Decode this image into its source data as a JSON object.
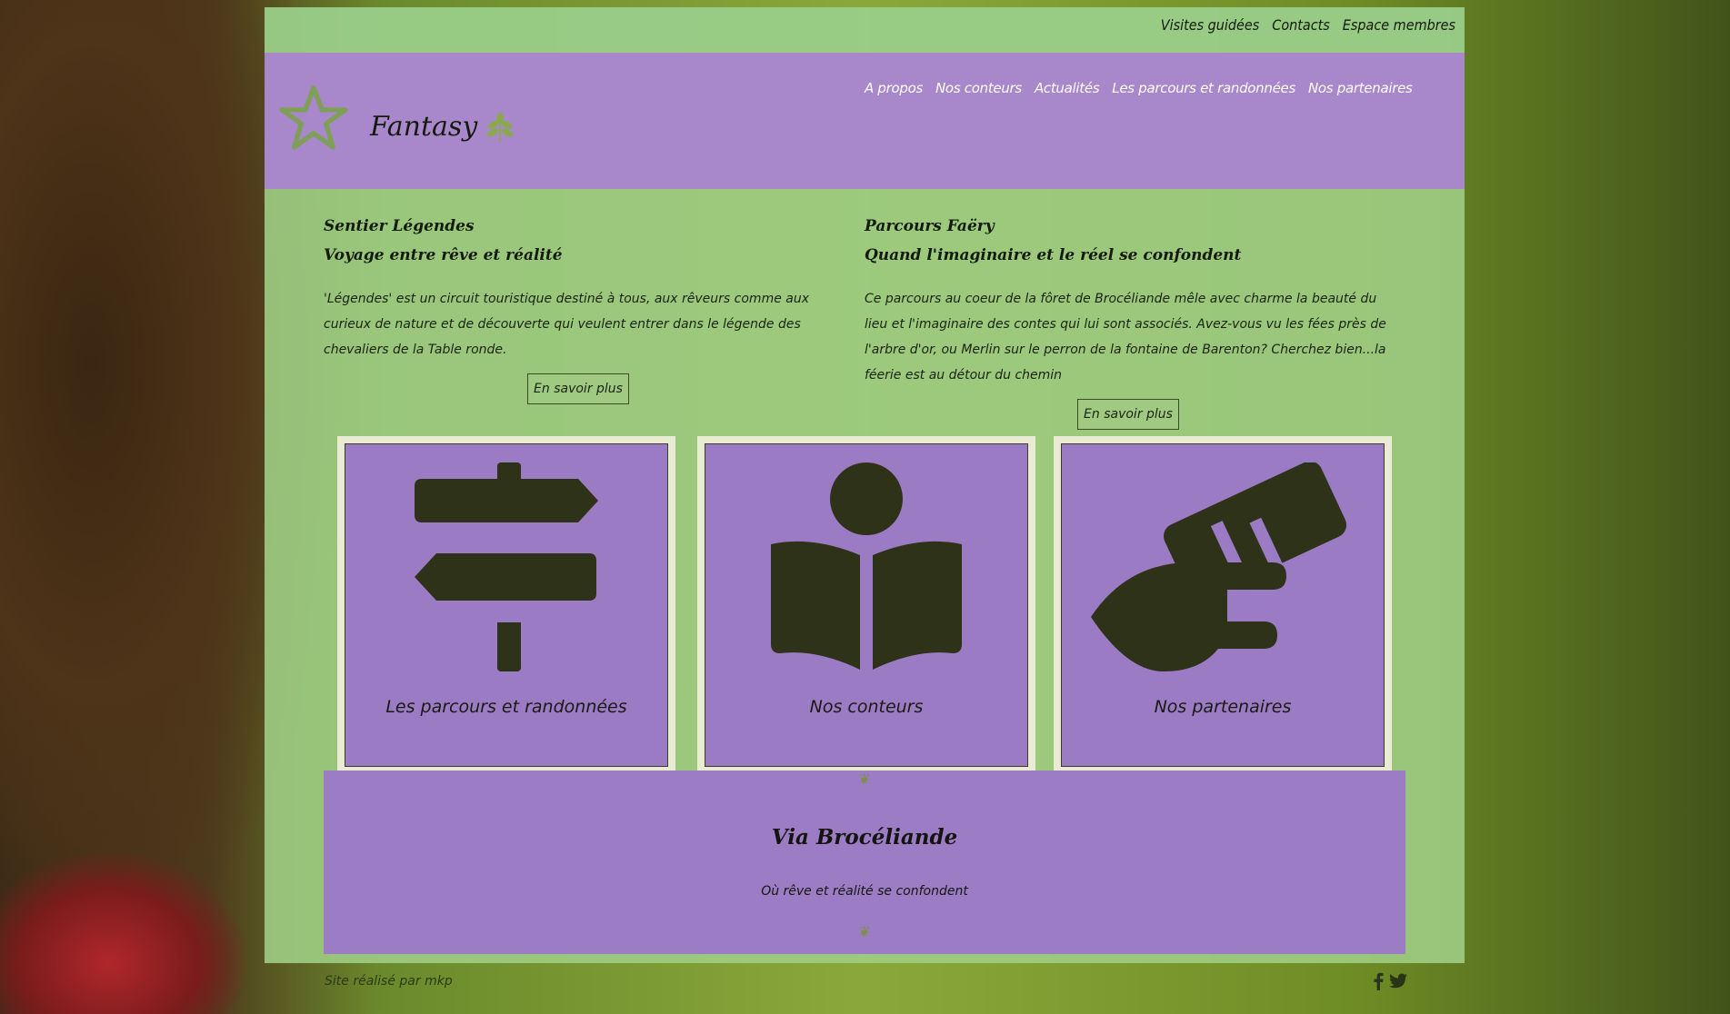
{
  "top_links": [
    "Visites guidées",
    "Contacts",
    "Espace membres"
  ],
  "header": {
    "brand": "Fantasy",
    "nav": [
      "A propos",
      "Nos conteurs",
      "Actualités",
      "Les parcours et randonnées",
      "Nos partenaires"
    ]
  },
  "features": [
    {
      "title": "Sentier Légendes",
      "subtitle": "Voyage entre rêve et réalité",
      "text": "'Légendes' est un circuit touristique destiné à tous, aux rêveurs comme aux curieux de nature et de découverte qui veulent entrer dans le légende des chevaliers de la Table ronde.",
      "button": "En savoir plus"
    },
    {
      "title": "Parcours Faëry",
      "subtitle": "Quand l'imaginaire et le réel se confondent",
      "text": "Ce parcours au coeur de la fôret de Brocéliande mêle avec charme la beauté du lieu et l'imaginaire des contes qui lui sont associés. Avez-vous vu les fées près de l'arbre d'or, ou Merlin sur le perron de la fontaine de Barenton? Cherchez bien...la féerie est au détour du chemin",
      "button": "En savoir plus"
    }
  ],
  "cards": [
    {
      "label": "Les parcours et randonnées",
      "icon": "signpost-icon"
    },
    {
      "label": "Nos conteurs",
      "icon": "reader-icon"
    },
    {
      "label": "Nos partenaires",
      "icon": "handshake-money-icon"
    }
  ],
  "banner": {
    "title": "Via Brocéliande",
    "subtitle": "Où rêve et réalité se confondent"
  },
  "footer": {
    "credit": "Site réalisé par mkp"
  },
  "colors": {
    "page_green": "#9ecd84",
    "header_purple": "#a987cb",
    "card_purple": "#9b7bc3",
    "card_frame": "#e9ecd3"
  }
}
